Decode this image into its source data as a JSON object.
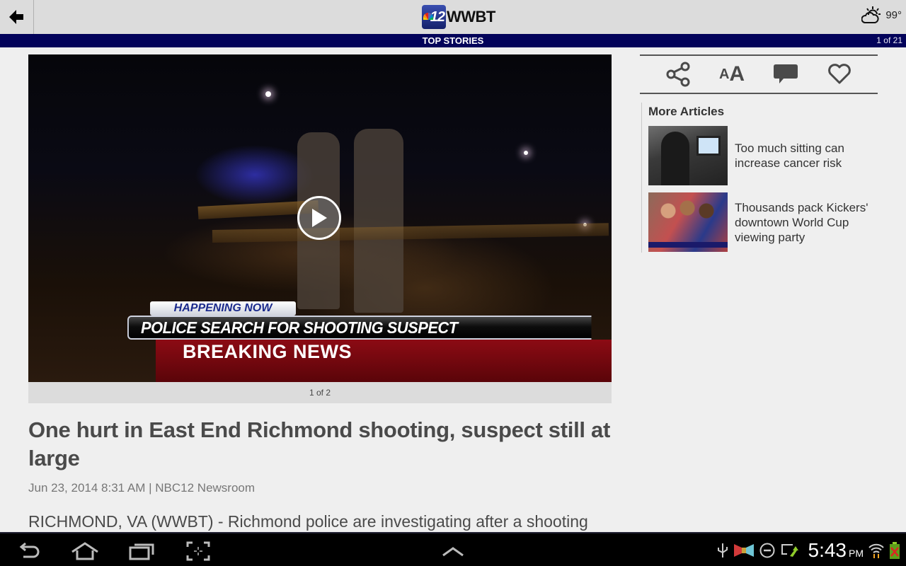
{
  "header": {
    "logo_number": "12",
    "logo_text": "WWBT",
    "weather_temp": "99°",
    "weather_icon": "partly-cloudy-icon"
  },
  "section": {
    "title": "TOP STORIES",
    "pager": "1 of 21"
  },
  "media": {
    "lower_third": {
      "tag": "HAPPENING NOW",
      "headline": "POLICE SEARCH FOR SHOOTING SUSPECT",
      "banner": "BREAKING NEWS"
    },
    "caption": "1 of 2"
  },
  "article": {
    "title": "One hurt in East End Richmond shooting, suspect still at large",
    "byline": "Jun 23, 2014 8:31 AM | NBC12 Newsroom",
    "body_first_line": "RICHMOND, VA (WWBT) - Richmond police are investigating after a shooting"
  },
  "toolbar": {
    "share": "share-icon",
    "text_size_small": "A",
    "text_size_big": "A",
    "comment": "comment-icon",
    "favorite": "heart-icon"
  },
  "more_articles": {
    "title": "More Articles",
    "items": [
      {
        "label": "Too much sitting can increase cancer risk"
      },
      {
        "label": "Thousands pack Kickers' downtown World Cup viewing party"
      }
    ]
  },
  "system_bar": {
    "time": "5:43",
    "ampm": "PM"
  }
}
